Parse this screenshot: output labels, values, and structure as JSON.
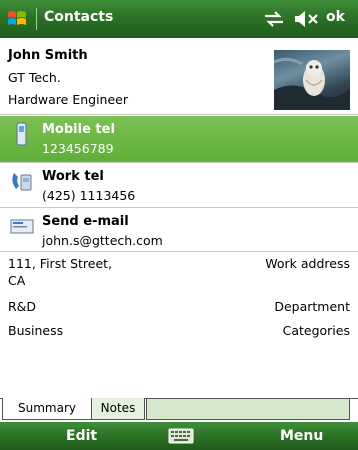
{
  "app": {
    "title": "Contacts",
    "ok_label": "ok"
  },
  "contact": {
    "name": "John Smith",
    "company": "GT Tech.",
    "job_title": "Hardware Engineer"
  },
  "rows": [
    {
      "label": "Mobile tel",
      "value": "123456789",
      "icon": "mobile-phone-icon",
      "selected": true
    },
    {
      "label": "Work tel",
      "value": "(425) 1113456",
      "icon": "work-phone-icon",
      "selected": false
    },
    {
      "label": "Send e-mail",
      "value": "john.s@gttech.com",
      "icon": "email-icon",
      "selected": false
    }
  ],
  "details": [
    {
      "value": "111, First Street,",
      "value2": "CA",
      "label": "Work address"
    },
    {
      "value": "R&D",
      "label": "Department"
    },
    {
      "value": "Business",
      "label": "Categories"
    }
  ],
  "tabs": [
    {
      "label": "Summary",
      "active": true
    },
    {
      "label": "Notes",
      "active": false
    }
  ],
  "softkeys": {
    "left": "Edit",
    "right": "Menu"
  },
  "colors": {
    "titlebar_green": "#2c7226",
    "selection_green": "#6cb845"
  }
}
